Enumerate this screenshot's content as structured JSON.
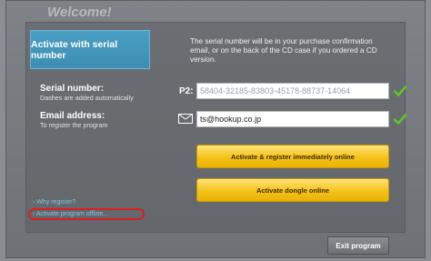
{
  "window": {
    "title": "Welcome!"
  },
  "tabs": {
    "serial_label": "Activate with serial number"
  },
  "description": "The serial number will be in your purchase confirmation email, or on the back of the CD case if you ordered a CD version.",
  "serial": {
    "label": "Serial number:",
    "sublabel": "Dashes are added automatically",
    "prefix": "P2:",
    "value": "58404-32185-83803-45178-88737-14064"
  },
  "email": {
    "label": "Email address:",
    "sublabel": "To register the program",
    "value": "ts@hookup.co.jp"
  },
  "buttons": {
    "activate_register": "Activate & register immediately online",
    "activate_dongle": "Activate dongle online",
    "exit": "Exit program"
  },
  "links": {
    "why_register": "› Why register?",
    "activate_offline": "› Activate program offline..."
  },
  "colors": {
    "accent": "#3d8db2",
    "button": "#f5c218",
    "check": "#5fc52a"
  }
}
